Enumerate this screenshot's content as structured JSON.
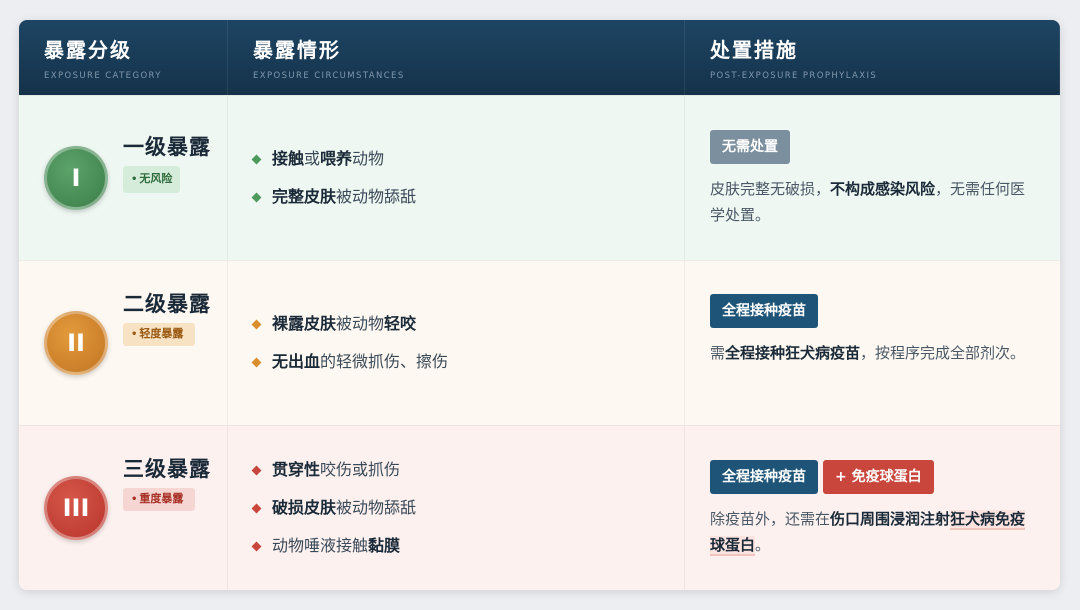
{
  "header": {
    "col1_title": "暴露分级",
    "col1_sub": "EXPOSURE CATEGORY",
    "col2_title": "暴露情形",
    "col2_sub": "EXPOSURE CIRCUMSTANCES",
    "col3_title": "处置措施",
    "col3_sub": "POST-EXPOSURE PROPHYLAXIS"
  },
  "rows": [
    {
      "numeral": "I",
      "name": "一级暴露",
      "tag": "无风险",
      "circ": [
        {
          "b1": "接触",
          "t1": "或",
          "b2": "喂养",
          "t2": "动物"
        },
        {
          "b1": "完整皮肤",
          "t1": "被动物舔舐"
        }
      ],
      "tags": [
        "无需处置"
      ],
      "desc": {
        "t1": "皮肤完整无破损，",
        "b1": "不构成感染风险",
        "t2": "，无需任何医学处置。"
      }
    },
    {
      "numeral": "II",
      "name": "二级暴露",
      "tag": "轻度暴露",
      "circ": [
        {
          "b1": "裸露皮肤",
          "t1": "被动物",
          "b2": "轻咬"
        },
        {
          "b1": "无出血",
          "t1": "的轻微抓伤、擦伤"
        }
      ],
      "tags": [
        "全程接种疫苗"
      ],
      "desc": {
        "t1": "需",
        "b1": "全程接种狂犬病疫苗",
        "t2": "，按程序完成全部剂次。"
      }
    },
    {
      "numeral": "III",
      "name": "三级暴露",
      "tag": "重度暴露",
      "circ": [
        {
          "b1": "贯穿性",
          "t1": "咬伤或抓伤"
        },
        {
          "b1": "破损皮肤",
          "t1": "被动物舔舐"
        },
        {
          "t1": "动物唾液接触",
          "b1": "黏膜"
        }
      ],
      "tags": [
        "全程接种疫苗",
        "+ 免疫球蛋白"
      ],
      "desc": {
        "t1": "除疫苗外，还需在",
        "b1": "伤口周围浸润注射",
        "b2": "狂犬病免疫球蛋白",
        "t2": "。"
      }
    }
  ],
  "colors": {
    "header_bg": "#15324a",
    "level1": "#3b7d49",
    "level2": "#c27523",
    "level3": "#b8352c",
    "tag_gray": "#7b8f9e",
    "tag_blue": "#1f5479",
    "tag_red": "#c8463b"
  }
}
